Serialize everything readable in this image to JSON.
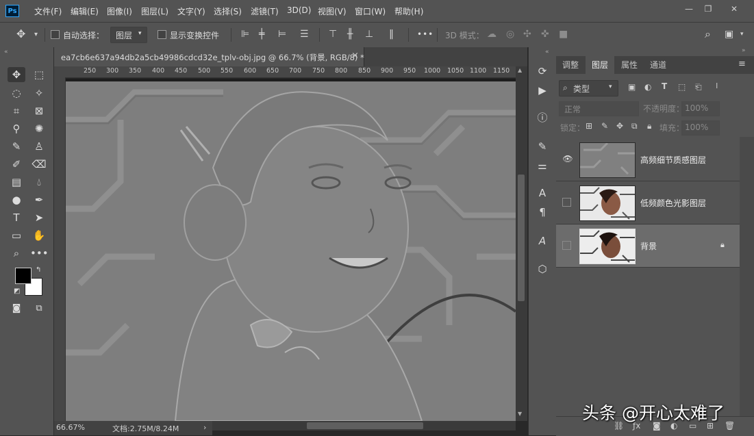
{
  "app": {
    "logo": "Ps"
  },
  "menu": [
    "文件(F)",
    "编辑(E)",
    "图像(I)",
    "图层(L)",
    "文字(Y)",
    "选择(S)",
    "滤镜(T)",
    "3D(D)",
    "视图(V)",
    "窗口(W)",
    "帮助(H)"
  ],
  "window_controls": {
    "minimize": "—",
    "restore": "❐",
    "close": "✕"
  },
  "options_bar": {
    "auto_select_label": "自动选择：",
    "auto_select_target": "图层",
    "show_transform_label": "显示变换控件",
    "mode_3d_label": "3D 模式：",
    "more_label": "•••"
  },
  "document": {
    "tab_title": "ea7cb6e637a94db2a5cb49986cdcd32e_tplv-obj.jpg @ 66.7% (背景, RGB/8) *",
    "close": "×",
    "ruler_ticks": [
      "250",
      "300",
      "350",
      "400",
      "450",
      "500",
      "550",
      "600",
      "650",
      "700",
      "750",
      "800",
      "850",
      "900",
      "950",
      "1000",
      "1050",
      "1100",
      "1150"
    ],
    "zoom": "66.67%",
    "doc_size": "文档:2.75M/8.24M",
    "status_arrow": "›"
  },
  "panel": {
    "tabs": [
      "调整",
      "图层",
      "属性",
      "通道"
    ],
    "active_tab": "图层",
    "filter_label": "类型",
    "blend_mode": "正常",
    "opacity_label": "不透明度：",
    "opacity_value": "100%",
    "lock_label": "锁定：",
    "fill_label": "填充：",
    "fill_value": "100%"
  },
  "layers": [
    {
      "name": "高频细节质感图层",
      "visible": true,
      "selected": false,
      "locked": false
    },
    {
      "name": "低频颜色光影图层",
      "visible": false,
      "selected": false,
      "locked": false
    },
    {
      "name": "背景",
      "visible": false,
      "selected": true,
      "locked": true
    }
  ],
  "watermark": "头条 @开心太难了",
  "colors": {
    "foreground": "#000000",
    "background": "#ffffff",
    "accent": "#31a8ff"
  }
}
